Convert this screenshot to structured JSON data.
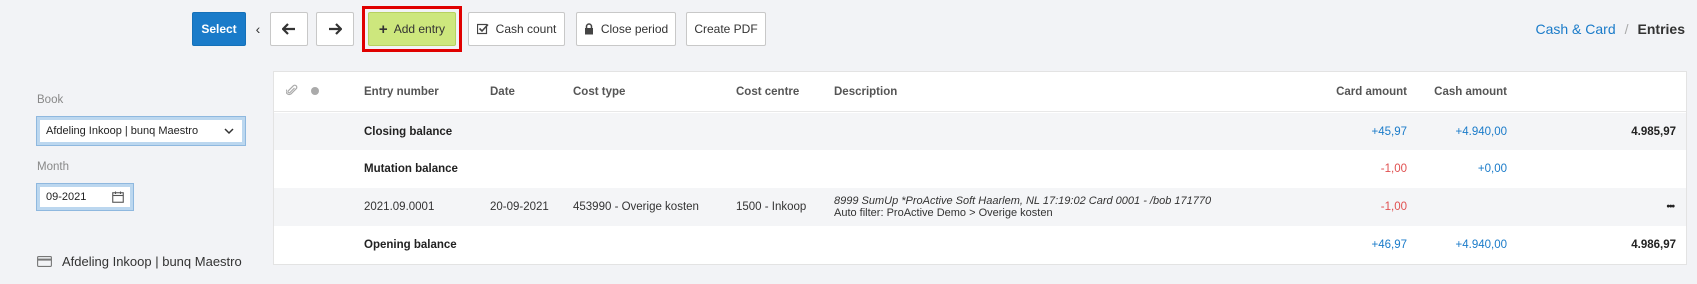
{
  "toolbar": {
    "select_label": "Select",
    "chevron": "‹",
    "back_icon": "arrow-left-icon",
    "forward_icon": "arrow-right-icon",
    "add_entry_label": "Add entry",
    "cash_count_label": "Cash count",
    "close_period_label": "Close period",
    "create_pdf_label": "Create PDF",
    "add_entry_color": "#cde77d",
    "select_color": "#1a7bc9",
    "highlight_color": "#e00000"
  },
  "breadcrumb": {
    "parent": "Cash & Card",
    "separator": "/",
    "current": "Entries"
  },
  "sidebar": {
    "book_label": "Book",
    "book_value": "Afdeling Inkoop | bunq Maestro",
    "month_label": "Month",
    "month_value": "09-2021",
    "account_name": "Afdeling Inkoop | bunq Maestro"
  },
  "table": {
    "columns": {
      "entry_number": "Entry number",
      "date": "Date",
      "cost_type": "Cost type",
      "cost_centre": "Cost centre",
      "description": "Description",
      "card_amount": "Card amount",
      "cash_amount": "Cash amount"
    },
    "closing": {
      "label": "Closing balance",
      "card": "+45,97",
      "cash": "+4.940,00",
      "total": "4.985,97"
    },
    "mutation": {
      "label": "Mutation balance",
      "card": "-1,00",
      "cash": "+0,00"
    },
    "entry": {
      "number": "2021.09.0001",
      "date": "20-09-2021",
      "cost_type": "453990 - Overige kosten",
      "cost_centre": "1500 - Inkoop",
      "desc_line1": "8999 SumUp *ProActive Soft Haarlem, NL 17:19:02 Card 0001 - /bob 171770",
      "desc_line2": "Auto filter: ProActive Demo > Overige kosten",
      "card": "-1,00",
      "menu": "•••"
    },
    "opening": {
      "label": "Opening balance",
      "card": "+46,97",
      "cash": "+4.940,00",
      "total": "4.986,97"
    }
  }
}
